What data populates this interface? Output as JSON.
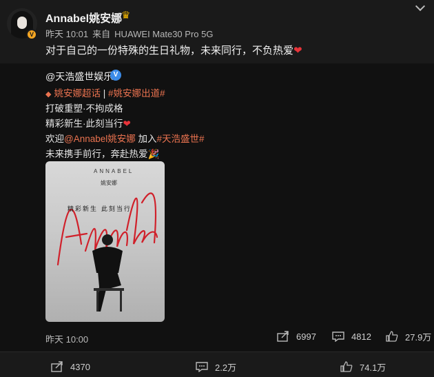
{
  "post": {
    "username": "Annabel姚安娜",
    "verified_badge": "V",
    "crown_icon": "crown-icon",
    "time": "昨天 10:01",
    "source_prefix": "来自",
    "source": "HUAWEI Mate30 Pro 5G",
    "text": "对于自己的一份特殊的生日礼物，未来同行，不负热爱",
    "heart": "❤"
  },
  "repost": {
    "author": "@天浩盛世娱乐",
    "author_badge": "V",
    "supertopic": "姚安娜超话",
    "separator": "|",
    "hashtag_debut": "#姚安娜出道#",
    "line2": "打破重塑·不拘成格",
    "line3": "精彩新生·此刻当行",
    "line3_heart": "❤",
    "line4_prefix": "欢迎",
    "line4_mention": "@Annabel姚安娜",
    "line4_mid": " 加入",
    "line4_hashtag": "#天浩盛世#",
    "line5": "未来携手前行，奔赴热爱",
    "line5_emoji": "🎉",
    "poster": {
      "title": "ANNABEL",
      "name": "姚安娜",
      "slogan": "精彩新生  此刻当行",
      "script": "Annabel"
    },
    "time": "昨天 10:00",
    "forwards": "6997",
    "comments": "4812",
    "likes": "27.9万"
  },
  "footer": {
    "forwards": "4370",
    "comments": "2.2万",
    "likes": "74.1万"
  },
  "colors": {
    "background": "#1a1a1a",
    "repost_background": "#111111",
    "link": "#eb7350",
    "verified_blue": "#3b8be8",
    "verified_orange": "#f5a623"
  }
}
